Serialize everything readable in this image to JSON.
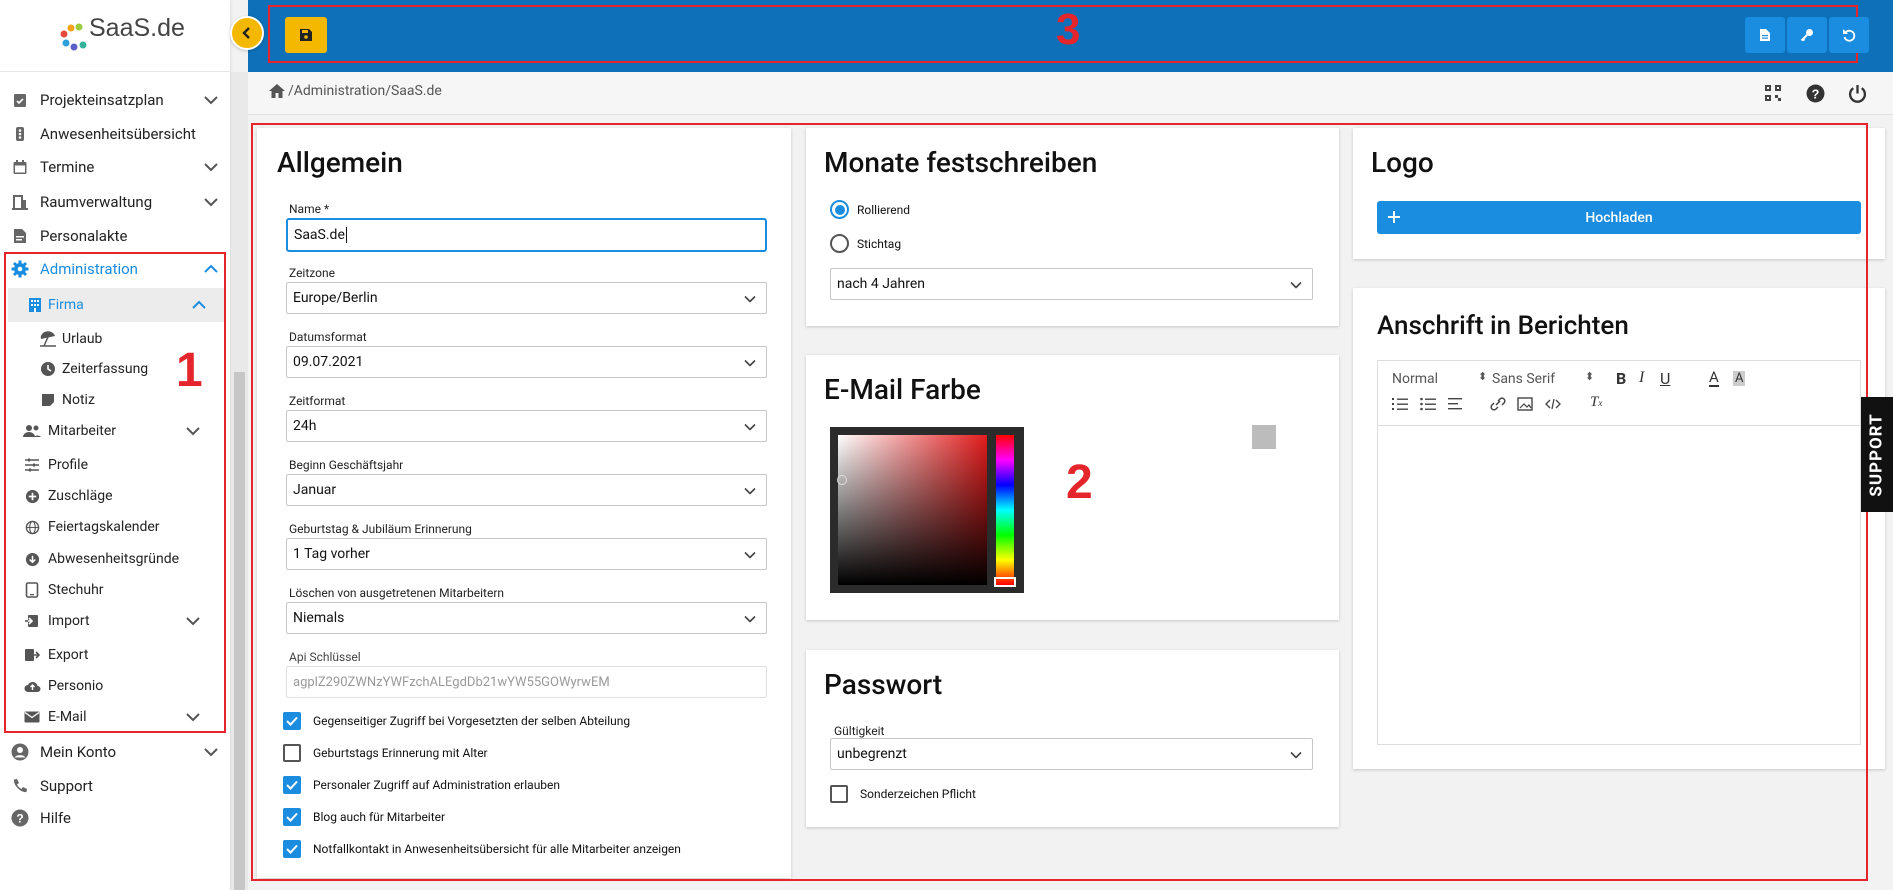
{
  "app": {
    "logo_text": "SaaS.de"
  },
  "sidebar": {
    "items": [
      {
        "label": "Projekteinsatzplan",
        "icon": "clipboard-check-icon"
      },
      {
        "label": "Anwesenheitsübersicht",
        "icon": "traffic-light-icon"
      },
      {
        "label": "Termine",
        "icon": "calendar-icon"
      },
      {
        "label": "Raumverwaltung",
        "icon": "door-icon"
      },
      {
        "label": "Personalakte",
        "icon": "file-icon"
      },
      {
        "label": "Administration",
        "icon": "gear-icon"
      },
      {
        "label": "Firma",
        "icon": "building-icon"
      },
      {
        "label": "Urlaub",
        "icon": "beach-umbrella-icon"
      },
      {
        "label": "Zeiterfassung",
        "icon": "clock-icon"
      },
      {
        "label": "Notiz",
        "icon": "note-icon"
      },
      {
        "label": "Mitarbeiter",
        "icon": "users-icon"
      },
      {
        "label": "Profile",
        "icon": "sliders-icon"
      },
      {
        "label": "Zuschläge",
        "icon": "plus-circle-icon"
      },
      {
        "label": "Feiertagskalender",
        "icon": "globe-icon"
      },
      {
        "label": "Abwesenheitsgründe",
        "icon": "download-circle-icon"
      },
      {
        "label": "Stechuhr",
        "icon": "tablet-icon"
      },
      {
        "label": "Import",
        "icon": "import-icon"
      },
      {
        "label": "Export",
        "icon": "export-icon"
      },
      {
        "label": "Personio",
        "icon": "cloud-upload-icon"
      },
      {
        "label": "E-Mail",
        "icon": "envelope-icon"
      },
      {
        "label": "Mein Konto",
        "icon": "user-circle-icon"
      },
      {
        "label": "Support",
        "icon": "phone-icon"
      },
      {
        "label": "Hilfe",
        "icon": "question-circle-icon"
      }
    ]
  },
  "breadcrumb": "/Administration/SaaS.de",
  "annotations": {
    "sidebar": "1",
    "content": "2",
    "toolbar": "3"
  },
  "allgemein": {
    "title": "Allgemein",
    "name_label": "Name *",
    "name_value": "SaaS.de",
    "fields": [
      {
        "label": "Zeitzone",
        "value": "Europe/Berlin"
      },
      {
        "label": "Datumsformat",
        "value": "09.07.2021"
      },
      {
        "label": "Zeitformat",
        "value": "24h"
      },
      {
        "label": "Beginn Geschäftsjahr",
        "value": "Januar"
      },
      {
        "label": "Geburtstag & Jubiläum Erinnerung",
        "value": "1 Tag vorher"
      },
      {
        "label": "Löschen von ausgetretenen Mitarbeitern",
        "value": "Niemals"
      }
    ],
    "api_label": "Api Schlüssel",
    "api_value": "agplZ290ZWNzYWFzchALEgdDb21wYW55GOWyrwEM",
    "checkboxes": [
      {
        "label": "Gegenseitiger Zugriff bei Vorgesetzten der selben Abteilung",
        "checked": true
      },
      {
        "label": "Geburtstags Erinnerung mit Alter",
        "checked": false
      },
      {
        "label": "Personaler Zugriff auf Administration erlauben",
        "checked": true
      },
      {
        "label": "Blog auch für Mitarbeiter",
        "checked": true
      },
      {
        "label": "Notfallkontakt in Anwesenheitsübersicht für alle Mitarbeiter anzeigen",
        "checked": true
      }
    ]
  },
  "monate": {
    "title": "Monate festschreiben",
    "radio1": "Rollierend",
    "radio2": "Stichtag",
    "selected": "Rollierend",
    "select_value": "nach 4 Jahren"
  },
  "email_farbe": {
    "title": "E-Mail Farbe",
    "current_color": "#bcbcbc"
  },
  "passwort": {
    "title": "Passwort",
    "label": "Gültigkeit",
    "value": "unbegrenzt",
    "checkbox": "Sonderzeichen Pflicht"
  },
  "logo": {
    "title": "Logo",
    "upload": "Hochladen"
  },
  "anschrift": {
    "title": "Anschrift in Berichten",
    "format": "Normal",
    "font": "Sans Serif"
  },
  "support_tab": "SUPPORT",
  "colors": {
    "primary": "#0e70b8",
    "accent": "#f5b800",
    "link": "#1a8de0",
    "annotation": "#e4262c"
  }
}
